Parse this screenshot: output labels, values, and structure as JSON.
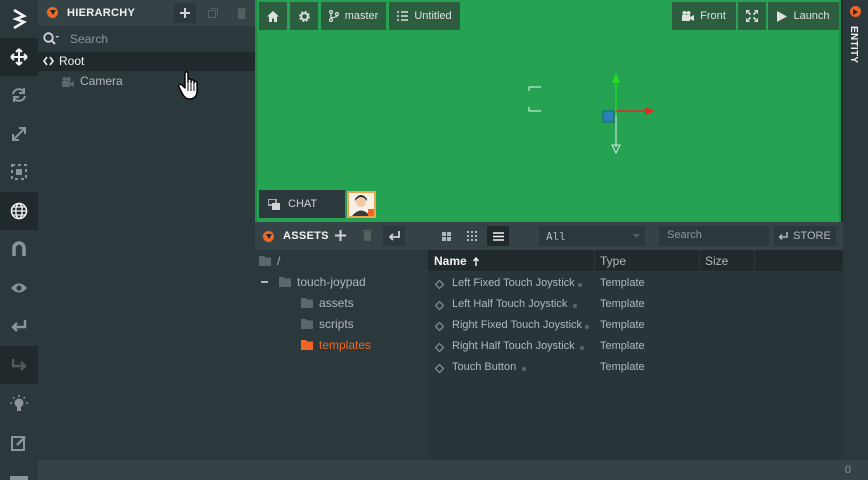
{
  "hierarchy": {
    "title": "HIERARCHY",
    "search_placeholder": "Search",
    "root_label": "Root",
    "camera_label": "Camera"
  },
  "viewport": {
    "branch_label": "master",
    "scene_label": "Untitled",
    "camera_label": "Front",
    "launch_label": "Launch",
    "chat_label": "CHAT"
  },
  "entity_tab": {
    "label": "ENTITY"
  },
  "assets": {
    "title": "ASSETS",
    "filter_value": "All",
    "search_placeholder": "Search",
    "store_label": "STORE",
    "folders": [
      {
        "label": "/"
      },
      {
        "label": "touch-joypad"
      },
      {
        "label": "assets"
      },
      {
        "label": "scripts"
      },
      {
        "label": "templates"
      }
    ],
    "columns": {
      "name": "Name",
      "type": "Type",
      "size": "Size"
    },
    "rows": [
      {
        "name": "Left Fixed Touch Joystick",
        "type": "Template"
      },
      {
        "name": "Left Half Touch Joystick",
        "type": "Template"
      },
      {
        "name": "Right Fixed Touch Joystick",
        "type": "Template"
      },
      {
        "name": "Right Half Touch Joystick",
        "type": "Template"
      },
      {
        "name": "Touch Button",
        "type": "Template"
      }
    ]
  },
  "status": {
    "count": "0"
  },
  "colors": {
    "accent": "#f26522",
    "viewport_bg": "#25a352",
    "panel_bg": "#2c393c"
  }
}
